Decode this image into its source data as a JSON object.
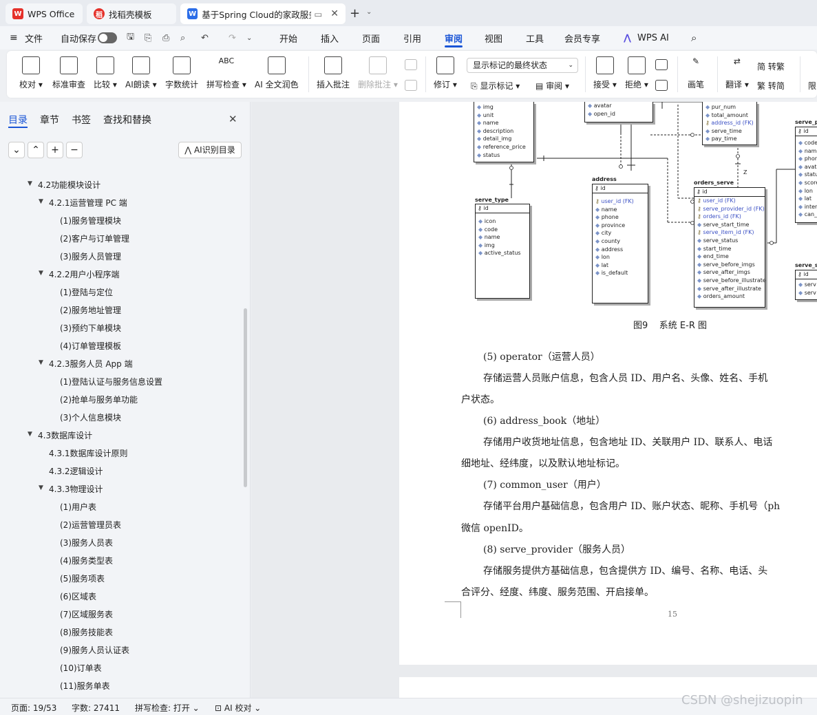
{
  "tabs": [
    {
      "label": "WPS Office"
    },
    {
      "label": "找稻壳模板"
    },
    {
      "label": "基于Spring Cloud的家政服务"
    }
  ],
  "menu": {
    "file": "文件",
    "autosave": "自动保存",
    "items": [
      "开始",
      "插入",
      "页面",
      "引用",
      "审阅",
      "视图",
      "工具",
      "会员专享"
    ],
    "ai": "WPS AI",
    "active": "审阅"
  },
  "ribbon": {
    "proofread": "校对",
    "std_review": "标准审查",
    "compare": "比较",
    "ai_read": "AI朗读",
    "word_count": "字数统计",
    "spell_check": "拼写检查",
    "ai_color": "AI 全文润色",
    "insert_comment": "插入批注",
    "delete_comment": "删除批注",
    "revise": "修订",
    "display_select": "显示标记的最终状态",
    "show_marks": "显示标记",
    "review": "审阅",
    "accept": "接受",
    "reject": "拒绝",
    "pen": "画笔",
    "translate": "翻译",
    "to_trad": "转繁",
    "to_simp": "转简",
    "restrict": "限"
  },
  "sidebar": {
    "tabs": [
      "目录",
      "章节",
      "书签",
      "查找和替换"
    ],
    "ai_toc": "AI识别目录",
    "toc": [
      {
        "label": "4.2功能模块设计",
        "level": 1,
        "expanded": true
      },
      {
        "label": "4.2.1运营管理 PC 端",
        "level": 2,
        "expanded": true
      },
      {
        "label": "(1)服务管理模块",
        "level": 3
      },
      {
        "label": "(2)客户与订单管理",
        "level": 3
      },
      {
        "label": "(3)服务人员管理",
        "level": 3
      },
      {
        "label": "4.2.2用户小程序端",
        "level": 2,
        "expanded": true
      },
      {
        "label": "(1)登陆与定位",
        "level": 3
      },
      {
        "label": "(2)服务地址管理",
        "level": 3
      },
      {
        "label": "(3)预约下单模块",
        "level": 3
      },
      {
        "label": "(4)订单管理模板",
        "level": 3
      },
      {
        "label": "4.2.3服务人员 App 端",
        "level": 2,
        "expanded": true
      },
      {
        "label": "(1)登陆认证与服务信息设置",
        "level": 3
      },
      {
        "label": "(2)抢单与服务单功能",
        "level": 3
      },
      {
        "label": "(3)个人信息模块",
        "level": 3
      },
      {
        "label": "4.3数据库设计",
        "level": 1,
        "expanded": true
      },
      {
        "label": "4.3.1数据库设计原则",
        "level": 2
      },
      {
        "label": "4.3.2逻辑设计",
        "level": 2
      },
      {
        "label": "4.3.3物理设计",
        "level": 2,
        "expanded": true
      },
      {
        "label": "(1)用户表",
        "level": 3
      },
      {
        "label": "(2)运营管理员表",
        "level": 3
      },
      {
        "label": "(3)服务人员表",
        "level": 3
      },
      {
        "label": "(4)服务类型表",
        "level": 3
      },
      {
        "label": "(5)服务项表",
        "level": 3
      },
      {
        "label": "(6)区域表",
        "level": 3
      },
      {
        "label": "(7)区域服务表",
        "level": 3
      },
      {
        "label": "(8)服务技能表",
        "level": 3
      },
      {
        "label": "(9)服务人员认证表",
        "level": 3
      },
      {
        "label": "(10)订单表",
        "level": 3
      },
      {
        "label": "(11)服务单表",
        "level": 3
      }
    ]
  },
  "er": {
    "serve_item_rows": [
      "img",
      "unit",
      "name",
      "description",
      "detail_img",
      "reference_price",
      "status"
    ],
    "admin_rows": [
      "avatar",
      "open_id"
    ],
    "orders_top_rows": [
      "pur_num",
      "total_amount",
      "address_id (FK)",
      "serve_time",
      "pay_time"
    ],
    "serve_type": {
      "title": "serve_type",
      "pk": "id",
      "rows": [
        "icon",
        "code",
        "name",
        "img",
        "active_status"
      ]
    },
    "address": {
      "title": "address",
      "pk": "id",
      "rows": [
        "user_id (FK)",
        "name",
        "phone",
        "province",
        "city",
        "county",
        "address",
        "lon",
        "lat",
        "is_default"
      ]
    },
    "orders_serve": {
      "title": "orders_serve",
      "pk": "id",
      "rows": [
        "user_id (FK)",
        "serve_provider_id (FK)",
        "orders_id (FK)",
        "serve_start_time",
        "serve_item_id (FK)",
        "serve_status",
        "start_time",
        "end_time",
        "serve_before_imgs",
        "serve_after_imgs",
        "serve_before_illustrate",
        "serve_after_illustrate",
        "orders_amount"
      ]
    },
    "serve_pr": {
      "title": "serve_pr",
      "pk": "id",
      "rows": [
        "code",
        "name",
        "phone",
        "avatar",
        "status",
        "score",
        "lon",
        "lat",
        "interv",
        "can_"
      ]
    },
    "serve_s": {
      "title": "serve_s",
      "pk": "id",
      "rows": [
        "serv",
        "serv"
      ]
    },
    "z_label": "Z",
    "caption": "图9    系统 E-R 图"
  },
  "doc": {
    "paras": [
      "(5) operator（运营人员）",
      "存储运营人员账户信息，包含人员 ID、用户名、头像、姓名、手机",
      "户状态。",
      "(6) address_book（地址）",
      "存储用户收货地址信息，包含地址 ID、关联用户 ID、联系人、电话",
      "细地址、经纬度，以及默认地址标记。",
      "(7) common_user（用户）",
      "存储平台用户基础信息，包含用户 ID、账户状态、昵称、手机号（ph",
      "微信 openID。",
      "(8) serve_provider（服务人员）",
      "存储服务提供方基础信息，包含提供方 ID、编号、名称、电话、头",
      "合评分、经度、纬度、服务范围、开启接单。"
    ],
    "page_number": "15"
  },
  "status": {
    "page": "页面: 19/53",
    "words": "字数: 27411",
    "spell": "拼写检查: 打开",
    "ai_check": "AI 校对",
    "watermark": "CSDN @shejizuopin"
  }
}
